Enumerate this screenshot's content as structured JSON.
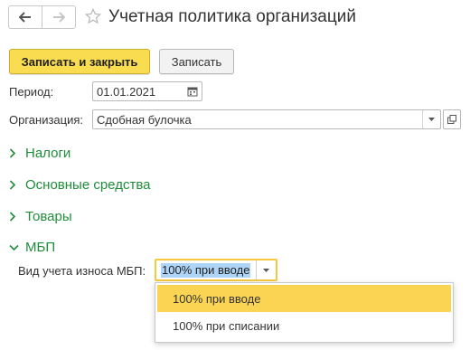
{
  "header": {
    "title": "Учетная политика организаций",
    "icons": {
      "back": "arrow-left-icon",
      "forward": "arrow-right-icon",
      "favorite": "star-icon"
    }
  },
  "toolbar": {
    "save_close_label": "Записать и закрыть",
    "save_label": "Записать"
  },
  "form": {
    "period": {
      "label": "Период:",
      "value": "01.01.2021"
    },
    "organization": {
      "label": "Организация:",
      "value": "Сдобная булочка"
    }
  },
  "groups": [
    {
      "label": "Налоги",
      "expanded": false
    },
    {
      "label": "Основные средства",
      "expanded": false
    },
    {
      "label": "Товары",
      "expanded": false
    },
    {
      "label": "МБП",
      "expanded": true
    }
  ],
  "mbp": {
    "label": "Вид учета износа МБП:",
    "selected": "100% при вводе",
    "options": [
      "100% при вводе",
      "100% при списании"
    ]
  },
  "colors": {
    "primary_button": "#f9dc4f",
    "group_link": "#1f8d3a",
    "focus_border": "#f7c83e",
    "selection": "#aed4f7",
    "active_option": "#fbd454"
  }
}
